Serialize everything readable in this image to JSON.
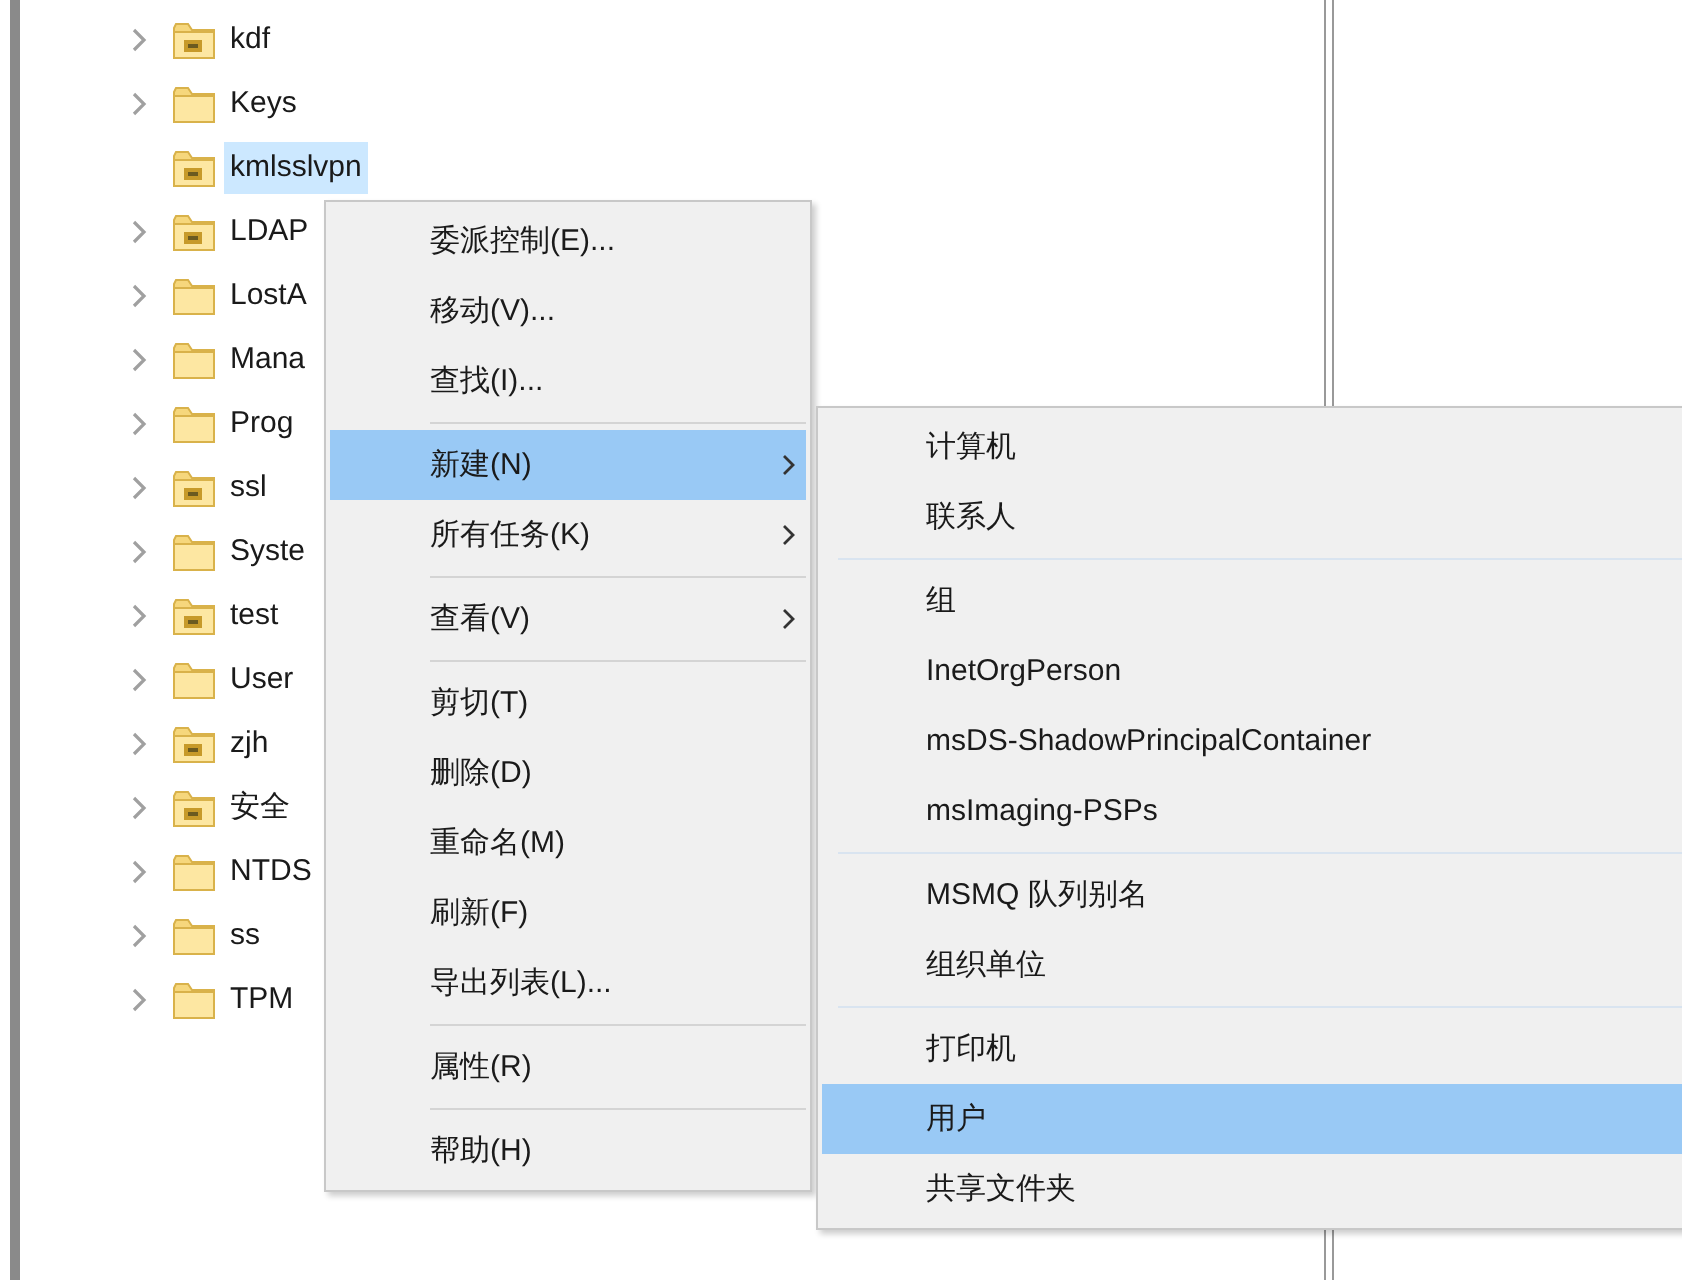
{
  "tree": {
    "items": [
      {
        "label": "kdf",
        "kind": "ou",
        "expandable": true,
        "selected": false
      },
      {
        "label": "Keys",
        "kind": "container",
        "expandable": true,
        "selected": false
      },
      {
        "label": "kmlsslvpn",
        "kind": "ou",
        "expandable": false,
        "selected": true
      },
      {
        "label": "LDAP",
        "kind": "ou",
        "expandable": true,
        "selected": false
      },
      {
        "label": "LostA",
        "kind": "container",
        "expandable": true,
        "selected": false
      },
      {
        "label": "Mana",
        "kind": "container",
        "expandable": true,
        "selected": false
      },
      {
        "label": "Prog",
        "kind": "container",
        "expandable": true,
        "selected": false
      },
      {
        "label": "ssl",
        "kind": "ou",
        "expandable": true,
        "selected": false
      },
      {
        "label": "Syste",
        "kind": "container",
        "expandable": true,
        "selected": false
      },
      {
        "label": "test",
        "kind": "ou",
        "expandable": true,
        "selected": false
      },
      {
        "label": "User",
        "kind": "container",
        "expandable": true,
        "selected": false
      },
      {
        "label": "zjh",
        "kind": "ou",
        "expandable": true,
        "selected": false
      },
      {
        "label": "安全",
        "kind": "ou",
        "expandable": true,
        "selected": false
      },
      {
        "label": "NTDS",
        "kind": "container",
        "expandable": true,
        "selected": false
      },
      {
        "label": "ss",
        "kind": "container",
        "expandable": true,
        "selected": false
      },
      {
        "label": "TPM",
        "kind": "container",
        "expandable": true,
        "selected": false
      }
    ]
  },
  "context_menu": {
    "groups": [
      [
        {
          "label": "委派控制(E)...",
          "submenu": false,
          "selected": false
        },
        {
          "label": "移动(V)...",
          "submenu": false,
          "selected": false
        },
        {
          "label": "查找(I)...",
          "submenu": false,
          "selected": false
        }
      ],
      [
        {
          "label": "新建(N)",
          "submenu": true,
          "selected": true
        },
        {
          "label": "所有任务(K)",
          "submenu": true,
          "selected": false
        }
      ],
      [
        {
          "label": "查看(V)",
          "submenu": true,
          "selected": false
        }
      ],
      [
        {
          "label": "剪切(T)",
          "submenu": false,
          "selected": false
        },
        {
          "label": "删除(D)",
          "submenu": false,
          "selected": false
        },
        {
          "label": "重命名(M)",
          "submenu": false,
          "selected": false
        },
        {
          "label": "刷新(F)",
          "submenu": false,
          "selected": false
        },
        {
          "label": "导出列表(L)...",
          "submenu": false,
          "selected": false
        }
      ],
      [
        {
          "label": "属性(R)",
          "submenu": false,
          "selected": false
        }
      ],
      [
        {
          "label": "帮助(H)",
          "submenu": false,
          "selected": false
        }
      ]
    ]
  },
  "submenu": {
    "groups": [
      [
        {
          "label": "计算机",
          "selected": false
        },
        {
          "label": "联系人",
          "selected": false
        }
      ],
      [
        {
          "label": "组",
          "selected": false
        },
        {
          "label": "InetOrgPerson",
          "selected": false
        },
        {
          "label": "msDS-ShadowPrincipalContainer",
          "selected": false
        },
        {
          "label": "msImaging-PSPs",
          "selected": false
        }
      ],
      [
        {
          "label": "MSMQ 队列别名",
          "selected": false
        },
        {
          "label": "组织单位",
          "selected": false
        }
      ],
      [
        {
          "label": "打印机",
          "selected": false
        },
        {
          "label": "用户",
          "selected": true
        },
        {
          "label": "共享文件夹",
          "selected": false
        }
      ]
    ]
  }
}
